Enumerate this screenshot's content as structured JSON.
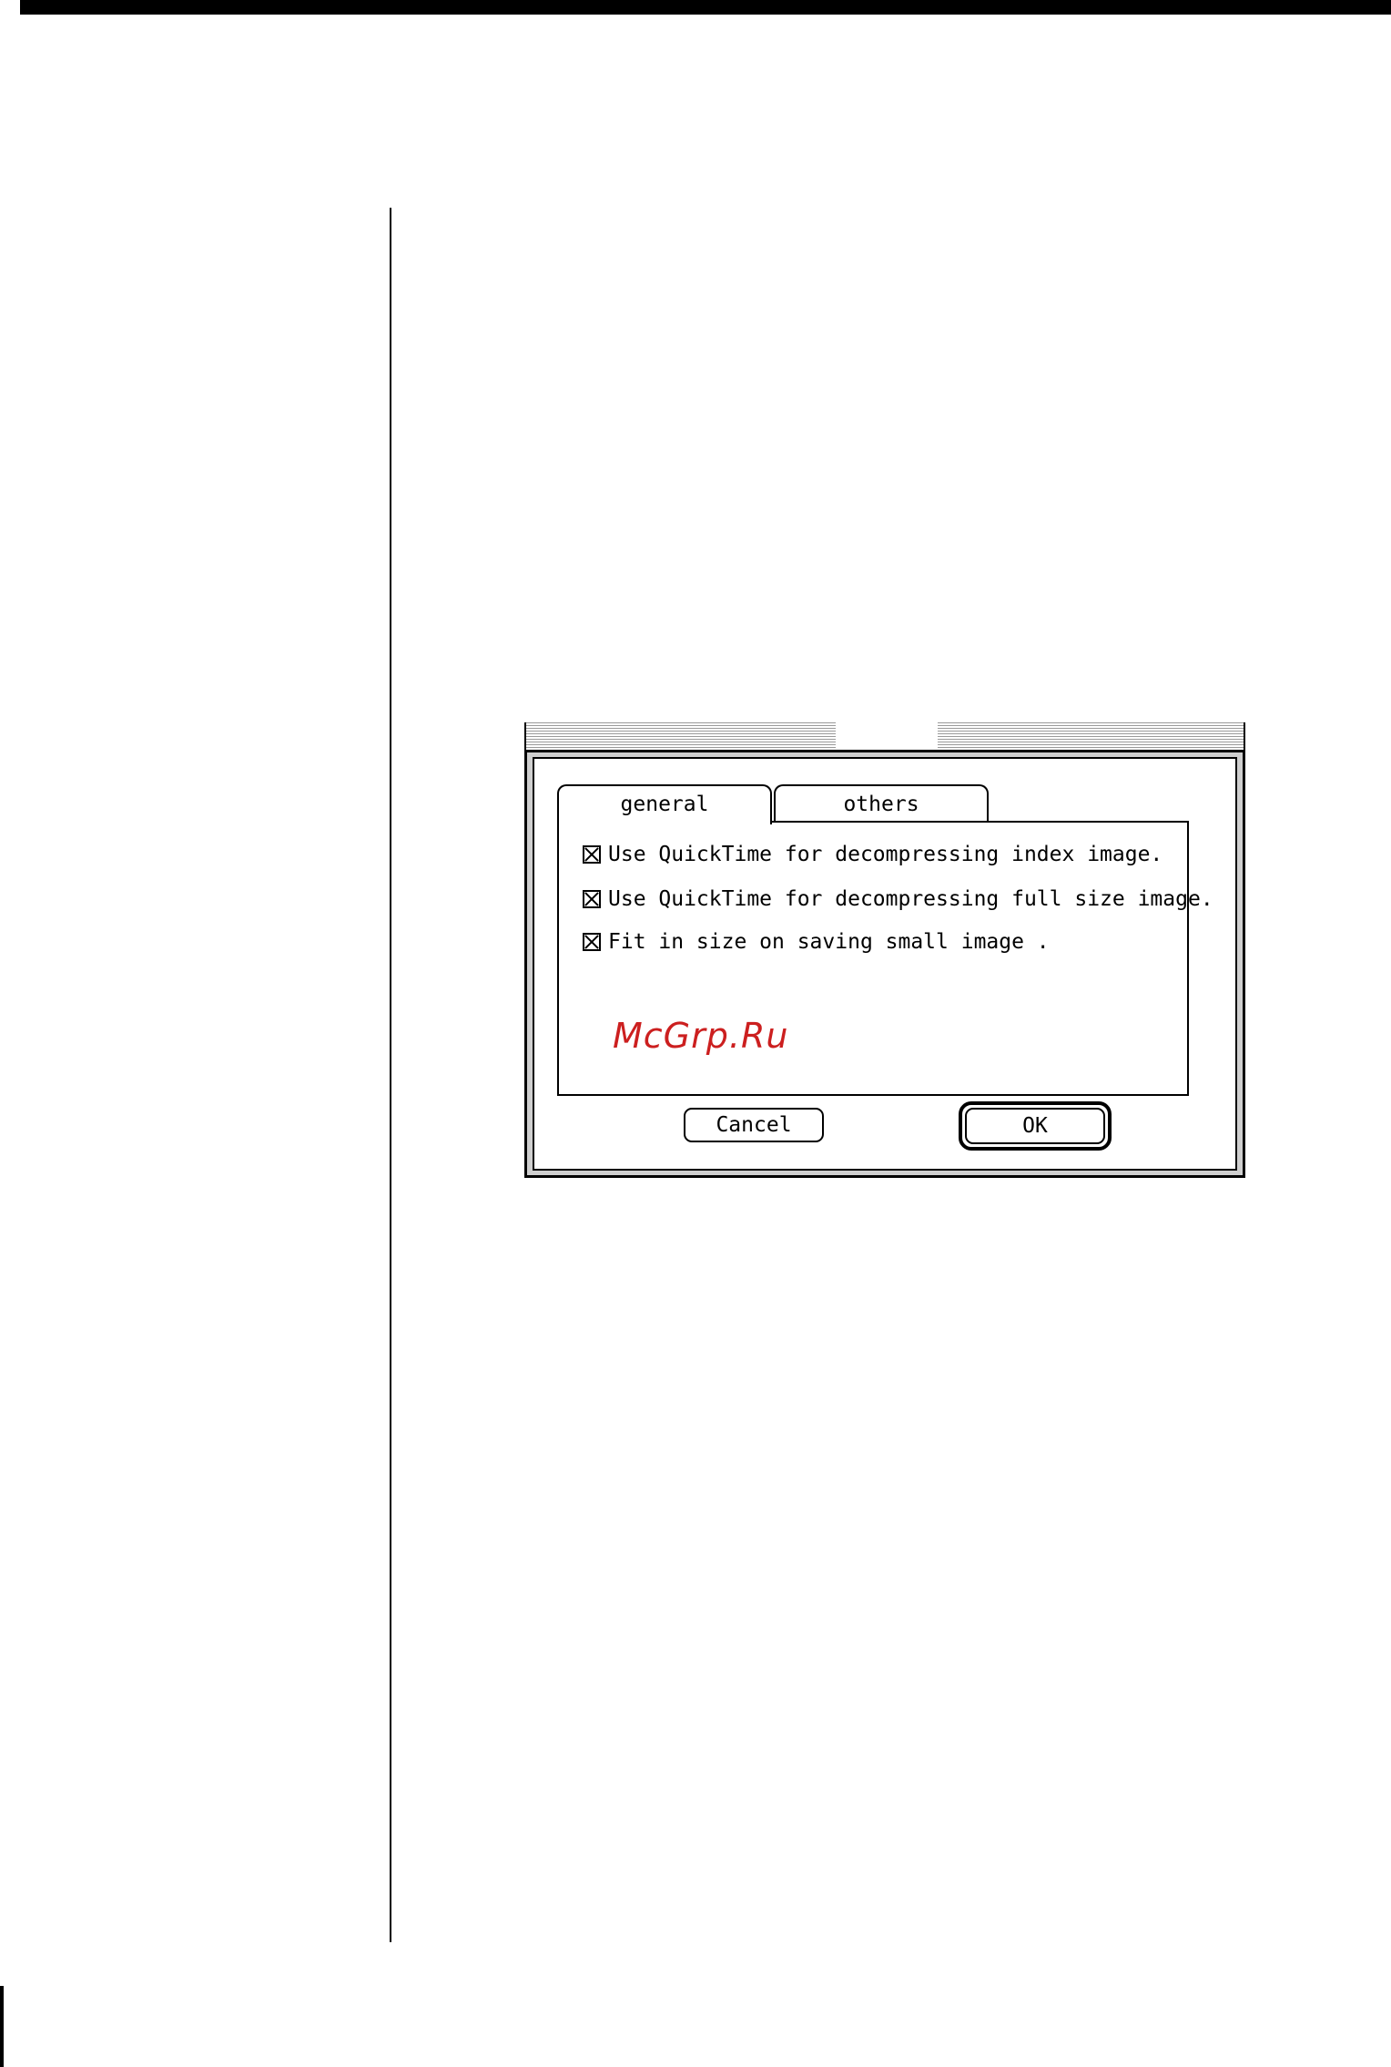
{
  "dialog": {
    "tabs": [
      {
        "label": "general",
        "selected": true
      },
      {
        "label": "others",
        "selected": false
      }
    ],
    "options": [
      {
        "label": "Use QuickTime for decompressing index image.",
        "checked": true
      },
      {
        "label": "Use QuickTime for decompressing full size image.",
        "checked": true
      },
      {
        "label": "Fit in size on saving small image .",
        "checked": true
      }
    ],
    "watermark": "McGrp.Ru",
    "buttons": {
      "cancel": "Cancel",
      "ok": "OK"
    }
  },
  "colors": {
    "watermark": "#cc1f1f",
    "frame": "#cfcfcf"
  }
}
